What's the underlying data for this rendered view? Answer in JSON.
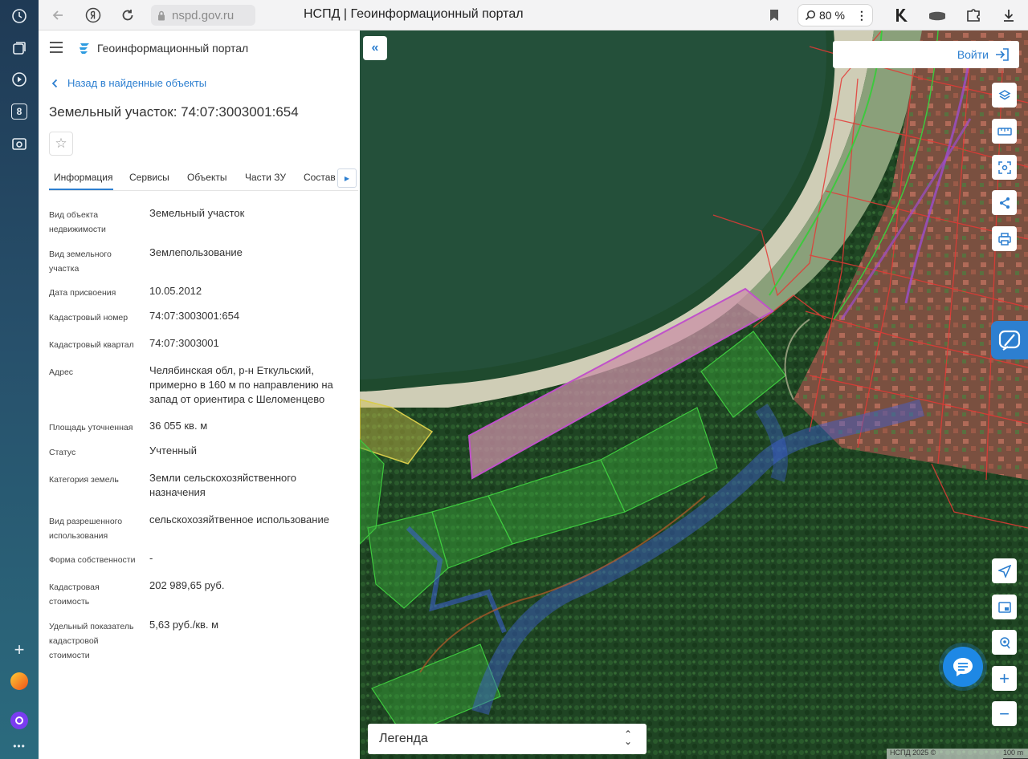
{
  "browser": {
    "url": "nspd.gov.ru",
    "title": "НСПД | Геоинформационный портал",
    "zoom": "80 %",
    "rail_badge": "8"
  },
  "panel": {
    "portal_title": "Геоинформационный портал",
    "back_label": "Назад в найденные объекты",
    "object_title": "Земельный участок: 74:07:3003001:654",
    "tabs": [
      "Информация",
      "Сервисы",
      "Объекты",
      "Части ЗУ",
      "Состав"
    ],
    "fields": [
      {
        "label": "Вид объекта недвижимости",
        "value": "Земельный участок"
      },
      {
        "label": "Вид земельного участка",
        "value": "Землепользование"
      },
      {
        "label": "Дата присвоения",
        "value": "10.05.2012"
      },
      {
        "label": "Кадастровый номер",
        "value": "74:07:3003001:654"
      },
      {
        "label": "Кадастровый квартал",
        "value": "74:07:3003001"
      },
      {
        "label": "Адрес",
        "value": "Челябинская обл, р-н Еткульский, примерно в 160 м по направлению на запад от ориентира с Шеломенцево"
      },
      {
        "label": "Площадь уточненная",
        "value": "36 055 кв. м"
      },
      {
        "label": "Статус",
        "value": "Учтенный"
      },
      {
        "label": "Категория земель",
        "value": "Земли сельскохозяйственного назначения"
      },
      {
        "label": "Вид разрешенного использования",
        "value": "сельскохозяйтвенное использование"
      },
      {
        "label": "Форма собственности",
        "value": "-"
      },
      {
        "label": "Кадастровая стоимость",
        "value": "202 989,65 руб."
      },
      {
        "label": "Удельный показатель кадастровой стоимости",
        "value": "5,63 руб./кв. м"
      }
    ]
  },
  "map": {
    "login_label": "Войти",
    "legend_label": "Легенда",
    "attribution": "НСПД 2025 ©",
    "scale_label": "100 m"
  },
  "colors": {
    "accent": "#2d7fd0",
    "selected_parcel": "#c052c9",
    "parcel_border": "#e53935"
  }
}
